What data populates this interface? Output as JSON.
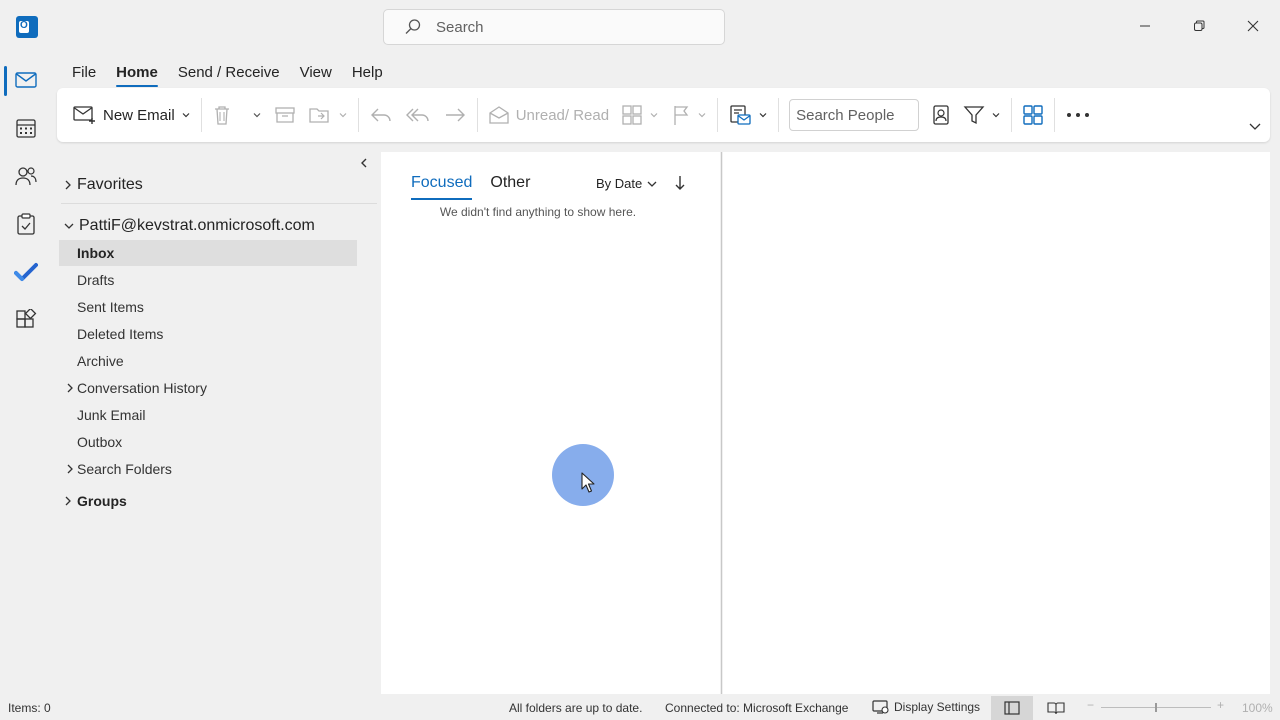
{
  "titlebar": {
    "app_icon": "outlook-app-icon",
    "search_placeholder": "Search",
    "controls": [
      "minimize-icon",
      "restore-icon",
      "close-icon"
    ]
  },
  "rail": {
    "items": [
      {
        "name": "mail",
        "icon": "mail-icon",
        "active": true
      },
      {
        "name": "calendar",
        "icon": "calendar-icon"
      },
      {
        "name": "people",
        "icon": "people-icon"
      },
      {
        "name": "tasks",
        "icon": "tasks-icon"
      },
      {
        "name": "todo",
        "icon": "todo-check-icon"
      },
      {
        "name": "apps",
        "icon": "apps-icon"
      }
    ]
  },
  "menu": {
    "tabs": [
      {
        "label": "File"
      },
      {
        "label": "Home",
        "active": true
      },
      {
        "label": "Send / Receive"
      },
      {
        "label": "View"
      },
      {
        "label": "Help"
      }
    ]
  },
  "ribbon": {
    "new_email": "New Email",
    "unread_read": "Unread/ Read",
    "search_people_placeholder": "Search People"
  },
  "folders": {
    "favorites": "Favorites",
    "account": "PattiF@kevstrat.onmicrosoft.com",
    "items": [
      {
        "label": "Inbox",
        "selected": true
      },
      {
        "label": "Drafts"
      },
      {
        "label": "Sent Items"
      },
      {
        "label": "Deleted Items"
      },
      {
        "label": "Archive"
      },
      {
        "label": "Conversation History",
        "expandable": true
      },
      {
        "label": "Junk Email"
      },
      {
        "label": "Outbox"
      },
      {
        "label": "Search Folders",
        "expandable": true
      }
    ],
    "groups": "Groups"
  },
  "message_list": {
    "tab_focused": "Focused",
    "tab_other": "Other",
    "sort_label": "By Date",
    "empty_text": "We didn't find anything to show here."
  },
  "status_bar": {
    "items_count": "Items: 0",
    "sync_status": "All folders are up to date.",
    "connection": "Connected to: Microsoft Exchange",
    "display_settings": "Display Settings",
    "zoom": "100%"
  },
  "colors": {
    "accent": "#0f6cbd",
    "cursor_highlight": "#5f91e6"
  }
}
